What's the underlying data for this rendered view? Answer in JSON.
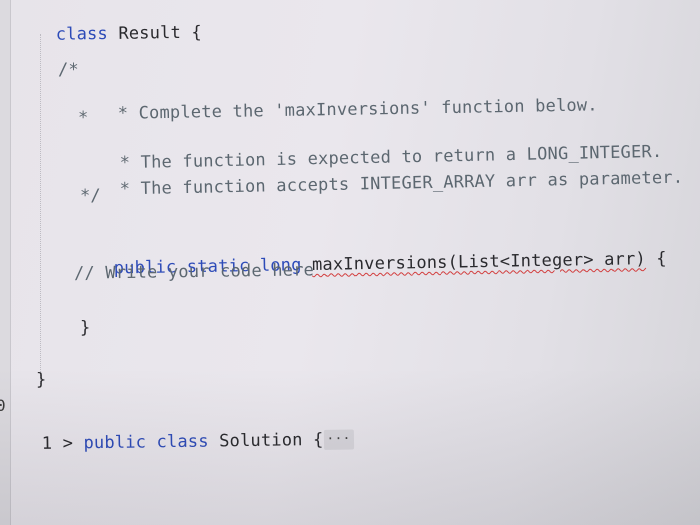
{
  "editor": {
    "line_class_result": {
      "kw": "class",
      "name": " Result ",
      "brace": "{"
    },
    "comment": {
      "open": "/*",
      "l1_star": "*",
      "l1_text": " Complete the 'maxInversions' function below.",
      "l2_star": "*",
      "l3_star": "*",
      "l3_text": " The function is expected to return a LONG_INTEGER.",
      "l4_star": "*",
      "l4_text": " The function accepts INTEGER_ARRAY arr as parameter.",
      "close": "*/"
    },
    "method_sig": {
      "mods": "public static long ",
      "name": "maxInversions(List<Integer> arr)",
      "brace": " {"
    },
    "body_comment": "// Write your code here",
    "method_close": "}",
    "class_close": "}",
    "solution_line": {
      "line_no": "1",
      "fold_arrow": ">",
      "mods": "public class ",
      "name": "Solution ",
      "brace": "{",
      "ellipsis": "···"
    },
    "gutter_marks": {
      "left_zero": "0"
    }
  },
  "colors": {
    "keyword": "#2d4bb8",
    "text": "#2a2a2e",
    "comment": "#5c6770",
    "error_squiggle": "#d23c3c",
    "background": "#e8e6eb"
  }
}
